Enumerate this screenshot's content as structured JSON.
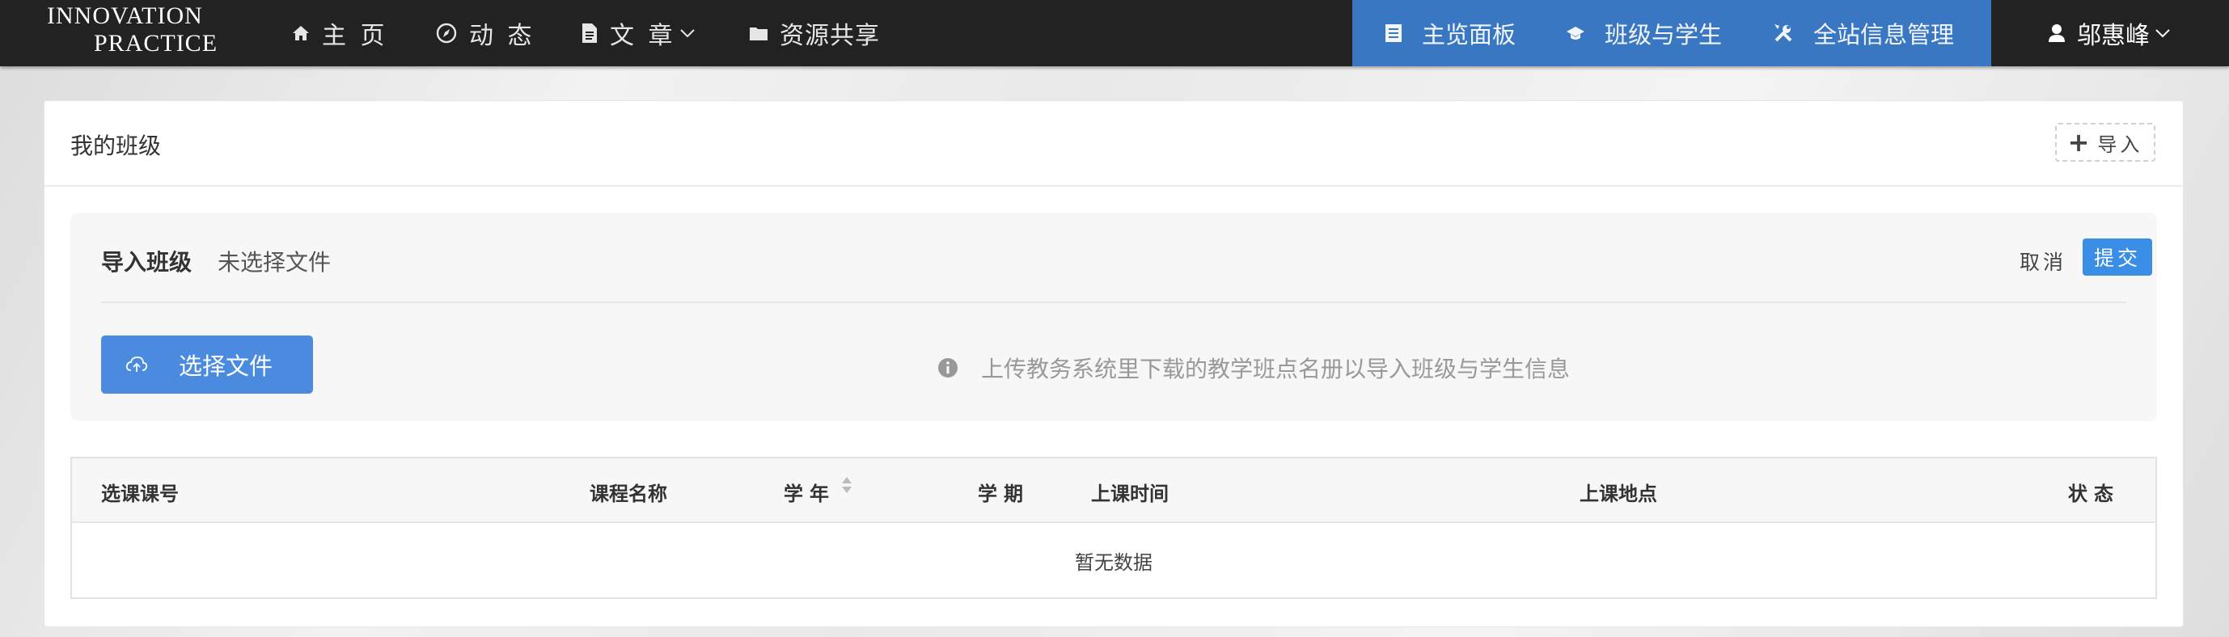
{
  "brand": {
    "line1": "INNOVATION",
    "line2": "PRACTICE"
  },
  "nav": {
    "home": "主 页",
    "feed": "动 态",
    "articles": "文 章",
    "resources": "资源共享"
  },
  "admin_nav": {
    "dashboard": "主览面板",
    "classes": "班级与学生",
    "site_admin": "全站信息管理"
  },
  "user": {
    "name": "邬惠峰"
  },
  "card": {
    "title": "我的班级",
    "import_label": "导入"
  },
  "upload": {
    "label": "导入班级",
    "file_status": "未选择文件",
    "cancel": "取消",
    "submit": "提交",
    "choose_file": "选择文件",
    "hint": "上传教务系统里下载的教学班点名册以导入班级与学生信息"
  },
  "table": {
    "columns": {
      "course_code": "选课课号",
      "course_name": "课程名称",
      "year": "学年",
      "term": "学期",
      "time": "上课时间",
      "location": "上课地点",
      "status": "状态"
    },
    "empty_text": "暂无数据"
  },
  "colors": {
    "topbar": "#222222",
    "admin_nav_bg": "#3a77c2",
    "primary_button": "#3a8ee6"
  },
  "icons": [
    "home-icon",
    "compass-icon",
    "document-icon",
    "folder-icon",
    "list-icon",
    "graduation-cap-icon",
    "tools-icon",
    "user-icon",
    "chevron-down-icon",
    "plus-icon",
    "cloud-upload-icon",
    "info-icon",
    "sort-icon"
  ]
}
